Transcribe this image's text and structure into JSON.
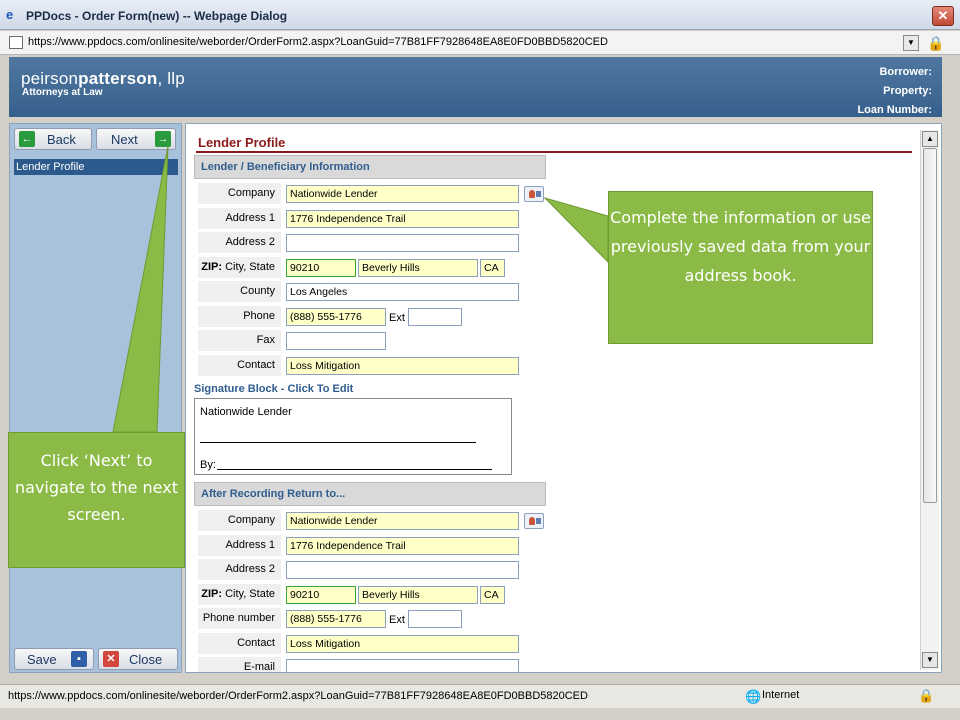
{
  "window": {
    "title": "PPDocs - Order Form(new) -- Webpage Dialog",
    "close_glyph": "✕",
    "address_url": "https://www.ppdocs.com/onlinesite/weborder/OrderForm2.aspx?LoanGuid=77B81FF7928648EA8E0FD0BBD5820CED"
  },
  "header": {
    "brand_prefix": "peirson",
    "brand_bold": "patterson",
    "brand_suffix": ", llp",
    "tagline": "Attorneys at Law",
    "borrower_label": "Borrower:",
    "property_label": "Property:",
    "loan_number_label": "Loan Number:"
  },
  "nav": {
    "back_label": "Back",
    "next_label": "Next",
    "items": [
      "Lender Profile"
    ],
    "save_label": "Save",
    "close_label": "Close"
  },
  "form": {
    "page_title": "Lender Profile",
    "lender_section": "Lender / Beneficiary Information",
    "lender": {
      "company_label": "Company",
      "company": "Nationwide Lender",
      "address1_label": "Address 1",
      "address1": "1776 Independence Trail",
      "address2_label": "Address 2",
      "address2": "",
      "zip_label_bold": "ZIP:",
      "zip_label_rest": " City, State",
      "zip": "90210",
      "city": "Beverly Hills",
      "state": "CA",
      "county_label": "County",
      "county": "Los Angeles",
      "phone_label": "Phone",
      "phone": "(888) 555-1776",
      "ext_label": "Ext",
      "ext": "",
      "fax_label": "Fax",
      "fax": "",
      "contact_label": "Contact",
      "contact": "Loss Mitigation"
    },
    "signature_block_title": "Signature Block - Click To Edit",
    "signature": {
      "line1": "Nationwide Lender",
      "by_label": "By:"
    },
    "return_section": "After Recording Return to...",
    "return_to": {
      "company_label": "Company",
      "company": "Nationwide Lender",
      "address1_label": "Address 1",
      "address1": "1776 Independence Trail",
      "address2_label": "Address 2",
      "address2": "",
      "zip_label_bold": "ZIP:",
      "zip_label_rest": " City, State",
      "zip": "90210",
      "city": "Beverly Hills",
      "state": "CA",
      "phone_label": "Phone number",
      "phone": "(888) 555-1776",
      "ext_label": "Ext",
      "ext": "",
      "contact_label": "Contact",
      "contact": "Loss Mitigation",
      "email_label": "E-mail",
      "email": ""
    }
  },
  "callouts": {
    "next_hint": "Click ‘Next’ to navigate to the next screen.",
    "address_book_hint": "Complete the information or use previously saved data from your address book."
  },
  "statusbar": {
    "url": "https://www.ppdocs.com/onlinesite/weborder/OrderForm2.aspx?LoanGuid=77B81FF7928648EA8E0FD0BBD5820CED",
    "zone": "Internet"
  },
  "colors": {
    "header_blue": "#3f6995",
    "section_title_red": "#8b1a1a",
    "callout_green": "#8bbb46",
    "field_yellow": "#ffffc8"
  }
}
